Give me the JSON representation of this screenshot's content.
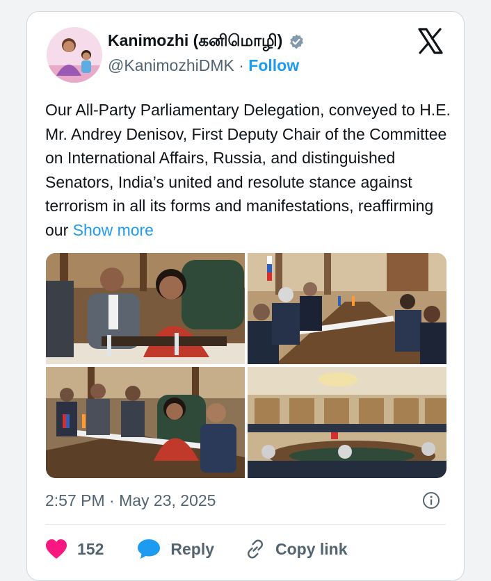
{
  "author": {
    "name": "Kanimozhi (கனிமொழி)",
    "handle": "@KanimozhiDMK",
    "separator": "·",
    "follow_label": "Follow"
  },
  "tweet": {
    "text": "Our All-Party Parliamentary Delegation, conveyed to H.E. Mr. Andrey Denisov, First Deputy Chair of the Committee on International Affairs, Russia, and distinguished Senators, India’s united and resolute stance against terrorism in all its forms and manifestations, reaffirming our",
    "show_more_label": "Show more"
  },
  "media": {
    "photos": [
      {
        "name": "photo-1",
        "subject": "delegation members seated at meeting table"
      },
      {
        "name": "photo-2",
        "subject": "bilateral meeting table with flags"
      },
      {
        "name": "photo-3",
        "subject": "delegation members speaking at table"
      },
      {
        "name": "photo-4",
        "subject": "wide view of conference hall meeting"
      }
    ]
  },
  "meta": {
    "timestamp": "2:57 PM · May 23, 2025"
  },
  "actions": {
    "like_count": "152",
    "reply_label": "Reply",
    "copy_link_label": "Copy link"
  },
  "colors": {
    "accent": "#1d9bf0",
    "like": "#f91880",
    "text": "#0f1419",
    "muted": "#536471"
  }
}
